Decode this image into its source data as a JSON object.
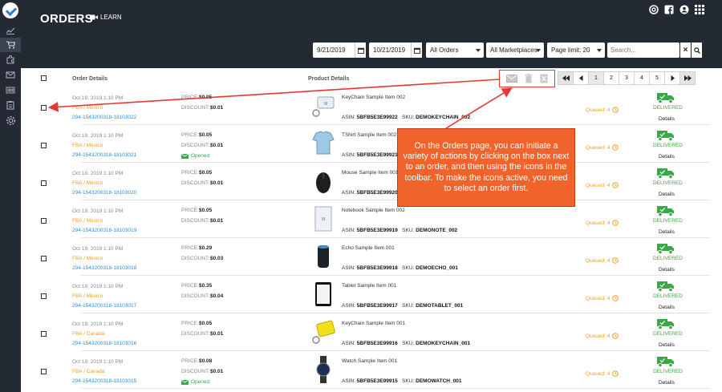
{
  "header": {
    "title": "ORDERS",
    "learn_label": "LEARN"
  },
  "filters": {
    "date_from": "9/21/2019",
    "date_to": "10/21/2019",
    "status": "All Orders",
    "marketplace": "All Marketplaces",
    "page_limit": "Page limit: 20",
    "search_placeholder": "Search..."
  },
  "table": {
    "col_order": "Order Details",
    "col_product": "Product Details"
  },
  "pagination": {
    "first": "⏮",
    "prev": "◂",
    "pages": [
      "1",
      "2",
      "3",
      "4",
      "5"
    ],
    "next": "▸",
    "last": "⏭",
    "current": "1"
  },
  "labels": {
    "price": "PRICE:",
    "discount": "DISCOUNT:",
    "asin": "ASIN:",
    "sku": "SKU:",
    "delivered": "DELIVERED",
    "details": "Details",
    "opened": "Opened"
  },
  "orders": [
    {
      "date": "Oct 19, 2019 1:10 PM",
      "channel": "FBA / Mexico",
      "order_id": "294-1543200318-18103022",
      "price": "$0.05",
      "discount": "$0.01",
      "opened": false,
      "product": "KeyChain Sample Item 002",
      "asin": "5BFB5E3E99922",
      "sku": "DEMOKEYCHAIN_002",
      "queued": "Queued: 4",
      "thumb": "keychain"
    },
    {
      "date": "Oct 19, 2019 1:10 PM",
      "channel": "FBA / Mexico",
      "order_id": "294-1543200318-18103021",
      "price": "$0.05",
      "discount": "$0.01",
      "opened": true,
      "product": "TShirt Sample Item 002",
      "asin": "5BFB5E3E99921",
      "sku": "",
      "queued": "Queued: 4",
      "thumb": "tshirt"
    },
    {
      "date": "Oct 19, 2019 1:10 PM",
      "channel": "FBA / Mexico",
      "order_id": "294-1543200318-18103020",
      "price": "$0.05",
      "discount": "$0.01",
      "opened": false,
      "product": "Mouse Sample Item 001",
      "asin": "5BFB5E3E99920",
      "sku": "",
      "queued": "Queued: 4",
      "thumb": "mouse"
    },
    {
      "date": "Oct 19, 2019 1:10 PM",
      "channel": "FBA / Mexico",
      "order_id": "294-1543200318-18103019",
      "price": "$0.05",
      "discount": "$0.01",
      "opened": false,
      "product": "Notebook Sample Item 002",
      "asin": "5BFB5E3E99919",
      "sku": "DEMONOTE_002",
      "queued": "Queued: 4",
      "thumb": "notebook"
    },
    {
      "date": "Oct 19, 2019 1:10 PM",
      "channel": "FBA / Mexico",
      "order_id": "294-1543200318-18103018",
      "price": "$0.29",
      "discount": "$0.03",
      "opened": false,
      "product": "Echo Sample Item 001",
      "asin": "5BFB5E3E99918",
      "sku": "DEMOECHO_001",
      "queued": "Queued: 4",
      "thumb": "echo"
    },
    {
      "date": "Oct 19, 2019 1:10 PM",
      "channel": "FBA / Mexico",
      "order_id": "294-1543200318-18103017",
      "price": "$0.35",
      "discount": "$0.04",
      "opened": false,
      "product": "Tablet Sample Item 001",
      "asin": "5BFB5E3E99917",
      "sku": "DEMOTABLET_001",
      "queued": "Queued: 4",
      "thumb": "tablet"
    },
    {
      "date": "Oct 19, 2019 1:10 PM",
      "channel": "FBA / Canada",
      "order_id": "294-1543200318-18103016",
      "price": "$0.05",
      "discount": "$0.01",
      "opened": false,
      "product": "KeyChain Sample Item 001",
      "asin": "5BFB5E3E99916",
      "sku": "DEMOKEYCHAIN_001",
      "queued": "Queued: 4",
      "thumb": "keychain2"
    },
    {
      "date": "Oct 19, 2019 1:10 PM",
      "channel": "FBA / Canada",
      "order_id": "294-1543200318-18103015",
      "price": "$0.08",
      "discount": "$0.01",
      "opened": true,
      "product": "Watch Sample Item 001",
      "asin": "5BFB5E3E99915",
      "sku": "DEMOWATCH_001",
      "queued": "Queued: 4",
      "thumb": "watch"
    }
  ],
  "callout": {
    "text": "On the Orders page, you can initiate a variety of actions by clicking on the box next to an order, and then using the icons in the toolbar. To make the icons active, you need to select an order first."
  },
  "colors": {
    "dark": "#232a33",
    "accent_orange": "#f0a020",
    "link_blue": "#2f8fd8",
    "delivered_green": "#3aa845",
    "callout": "#f0642c",
    "highlight_red": "#e53935"
  },
  "icons": {
    "sidebar": [
      "logo-icon",
      "chart-icon",
      "cart-icon",
      "puzzle-icon",
      "mail-icon",
      "barcode-icon",
      "clipboard-icon",
      "gear-icon"
    ],
    "topbar": [
      "lifebuoy-icon",
      "facebook-icon",
      "user-icon",
      "grid-icon"
    ],
    "toolbar": [
      "email-icon",
      "trash-icon",
      "cancel-icon"
    ]
  }
}
